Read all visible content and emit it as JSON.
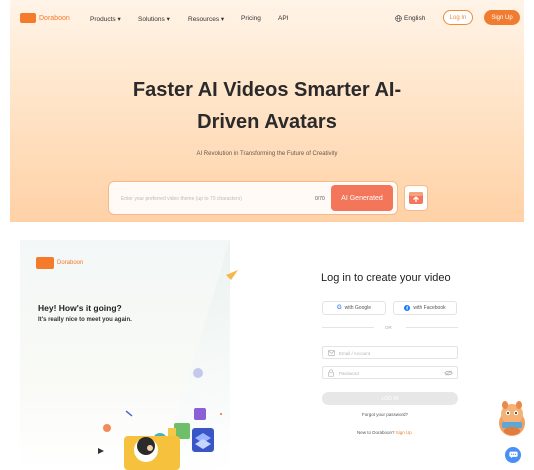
{
  "nav": {
    "brand": "Doraboon",
    "items": [
      {
        "label": "Products",
        "chevron": true
      },
      {
        "label": "Solutions",
        "chevron": true
      },
      {
        "label": "Resources",
        "chevron": true
      },
      {
        "label": "Pricing",
        "chevron": false
      },
      {
        "label": "API",
        "chevron": false
      }
    ],
    "language": "English",
    "login": "Log In",
    "signup": "Sign Up"
  },
  "hero": {
    "title_line1": "Faster AI Videos Smarter AI-",
    "title_line2": "Driven Avatars",
    "subtitle": "AI Revolution in Transforming the Future of Creativity",
    "search_placeholder": "Enter your preferred video theme (up to 70 characters)",
    "char_count": "0/70",
    "generate_label": "AI Generated"
  },
  "login_page": {
    "brand": "Doraboon",
    "greeting": "Hey!  How's it going?",
    "greeting_sub": "It's really nice to meet you again.",
    "title": "Log in to create your video",
    "google_label": "with Google",
    "facebook_label": "with Facebook",
    "or_label": "OR",
    "email_placeholder": "Email / Account",
    "password_placeholder": "Password",
    "login_button": "LOG IN",
    "forgot": "Forgot your password?",
    "new_prompt": "New to Doraboon?",
    "signup_link": "Sign Up"
  },
  "colors": {
    "accent": "#f07c32",
    "hero_button": "#f3765b",
    "chat": "#4a8ff5"
  }
}
